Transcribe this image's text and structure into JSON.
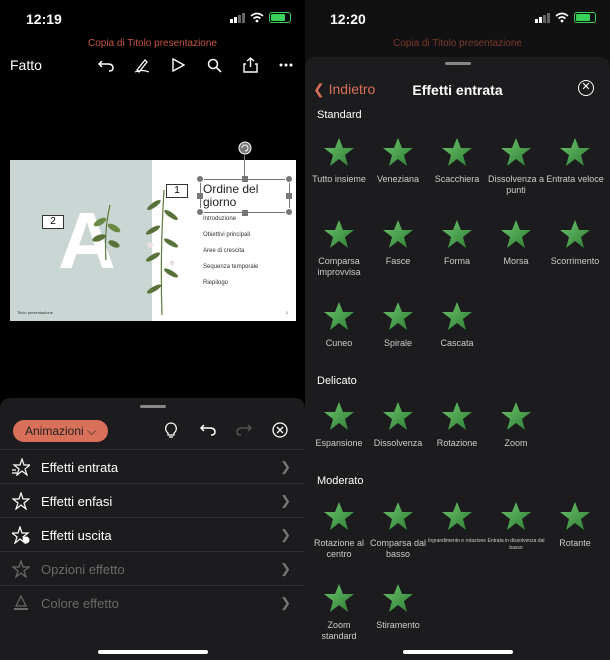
{
  "left": {
    "status_time": "12:19",
    "doc_title": "Copia di Titolo presentazione",
    "done_label": "Fatto",
    "toolbar_icons": [
      "undo-icon",
      "pen-icon",
      "play-icon",
      "search-icon",
      "share-icon",
      "more-icon"
    ],
    "slide": {
      "big_letter": "A",
      "num1": "1",
      "num2": "2",
      "heading": "Ordine del giorno",
      "items": [
        "Introduzione",
        "Obiettivi principali",
        "Aree di crescita",
        "Sequenza temporale",
        "Riepilogo"
      ],
      "footer": "Titolo presentazione",
      "page": "1"
    },
    "sheet": {
      "animations_button": "Animazioni",
      "icons": [
        "lightbulb-icon",
        "undo-icon",
        "redo-icon",
        "close-icon"
      ],
      "menu": [
        {
          "label": "Effetti entrata",
          "enabled": true
        },
        {
          "label": "Effetti enfasi",
          "enabled": true
        },
        {
          "label": "Effetti uscita",
          "enabled": true
        },
        {
          "label": "Opzioni effetto",
          "enabled": false
        },
        {
          "label": "Colore effetto",
          "enabled": false
        }
      ]
    }
  },
  "right": {
    "status_time": "12:20",
    "doc_title": "Copia di Titolo presentazione",
    "back_label": "Indietro",
    "title": "Effetti entrata",
    "sections": [
      {
        "title": "Standard",
        "effects": [
          "Tutto insieme",
          "Veneziana",
          "Scacchiera",
          "Dissolvenza a punti",
          "Entrata veloce",
          "Comparsa improvvisa",
          "Fasce",
          "Forma",
          "Morsa",
          "Scorrimento",
          "Cuneo",
          "Spirale",
          "Cascata"
        ]
      },
      {
        "title": "Delicato",
        "effects": [
          "Espansione",
          "Dissolvenza",
          "Rotazione",
          "Zoom"
        ]
      },
      {
        "title": "Moderato",
        "effects": [
          "Rotazione al centro",
          "Comparsa dal basso",
          "Ingrandimento e rotazione",
          "Entrata in dissolvenza dal basso",
          "Rotante",
          "Zoom standard",
          "Stiramento"
        ]
      }
    ]
  },
  "colors": {
    "accent": "#d9705a",
    "star_green": "#4caf50",
    "title_red": "#c8553d"
  }
}
